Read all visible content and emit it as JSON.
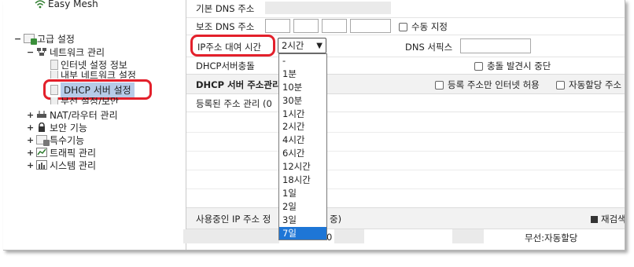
{
  "sidebar": {
    "items": [
      {
        "label": "Easy Mesh"
      },
      {
        "label": "고급 설정"
      },
      {
        "label": "네트워크 관리"
      },
      {
        "label": "인터넷 설정 정보"
      },
      {
        "label": "내부 네트워크 설정"
      },
      {
        "label": "DHCP 서버 설정"
      },
      {
        "label": "무선 설정/보안"
      },
      {
        "label": "NAT/라우터 관리"
      },
      {
        "label": "보안 기능"
      },
      {
        "label": "특수기능"
      },
      {
        "label": "트래픽 관리"
      },
      {
        "label": "시스템 관리"
      }
    ]
  },
  "main": {
    "primary_dns_label": "기본 DNS 주소",
    "secondary_dns_label": "보조 DNS 주소",
    "manual_label": "수동 지정",
    "lease_label": "IP주소 대여 시간",
    "lease_selected": "2시간",
    "dns_suffix_label": "DNS 서픽스",
    "conflict_label": "DHCP서버충돌",
    "stop_on_conflict_label": "충돌 발견시 중단",
    "addr_section_label": "DHCP 서버 주소관리",
    "registered_only_label": "등록 주소만 인터넷 허용",
    "auto_assign_label": "자동할당 주소",
    "registered_addr_label": "등록된 주소 관리 (0",
    "in_use_label": "사용중인 IP 주소 정",
    "in_use_suffix": "중)",
    "rescan_label": "재검색",
    "wireless_auto_label": "무선:자동할당",
    "bottom_partial": "0"
  },
  "lease_options": [
    "-",
    "1분",
    "10분",
    "30분",
    "1시간",
    "2시간",
    "4시간",
    "6시간",
    "12시간",
    "18시간",
    "1일",
    "2일",
    "3일",
    "7일"
  ],
  "lease_highlighted_option": "7일",
  "colors": {
    "highlight_red": "#e3202b",
    "selection_blue": "#1e76d6",
    "tree_selection": "#b6cbe8"
  }
}
